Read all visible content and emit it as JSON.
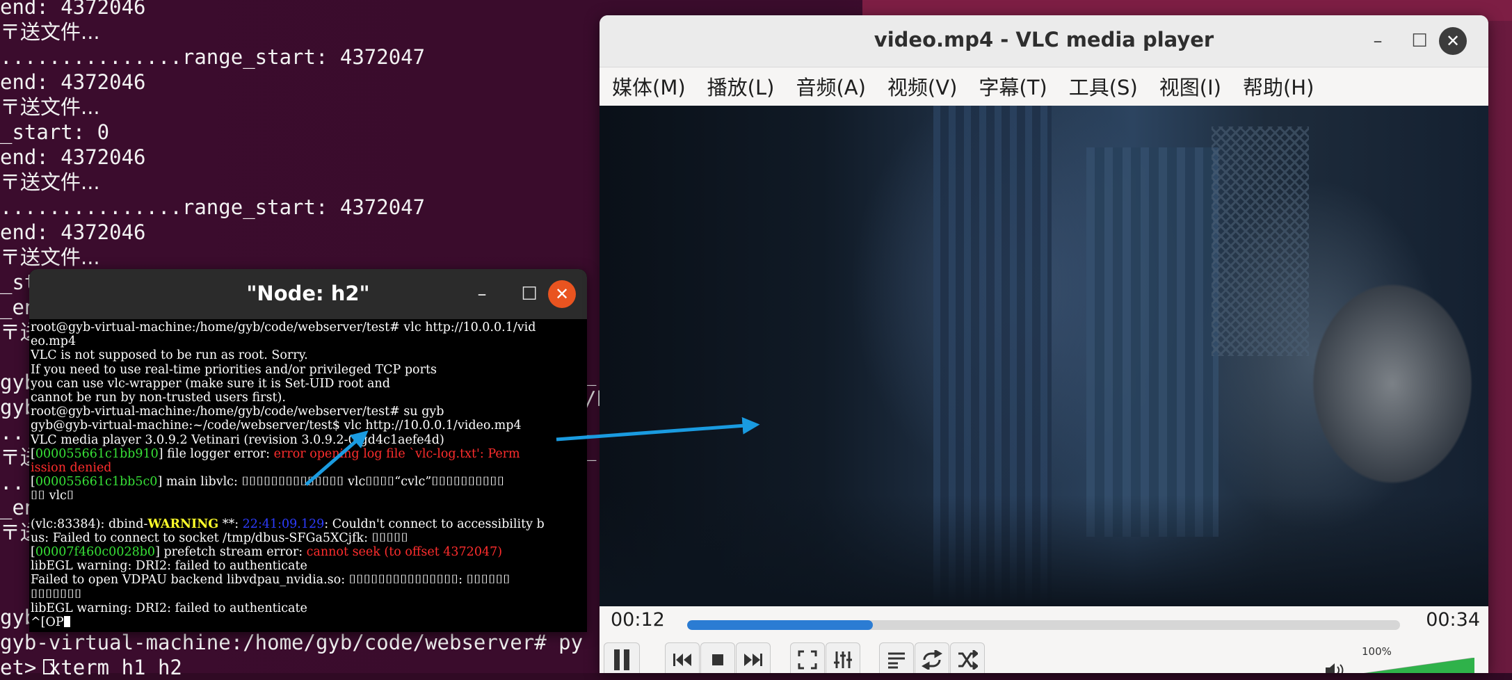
{
  "background_terminal": {
    "lines": [
      "end: 4372046",
      "〒送文件...",
      "...............range_start: 4372047",
      "end: 4372046",
      "〒送文件...",
      "_start: 0",
      "end: 4372046",
      "〒送文件...",
      "...............range_start: 4372047",
      "end: 4372046",
      "〒送文件...",
      "_st",
      "_en",
      "〒送",
      "",
      "gyb",
      "gyb",
      "..",
      "〒送",
      "..",
      "_en",
      "〒送",
      ""
    ],
    "right_fragments": [
      "_",
      "/h",
      "_",
      "_",
      ""
    ],
    "bottom_lines": [
      "gyb",
      "gyb-virtual-machine:/home/gyb/code/webserver# py",
      "et> xterm h1 h2"
    ]
  },
  "xterm": {
    "title": "\"Node: h2\"",
    "min_glyph": "–",
    "max_glyph": "☐",
    "close_glyph": "✕",
    "lines": [
      {
        "t": "root@gyb-virtual-machine:/home/gyb/code/webserver/test# vlc http://10.0.0.1/vid"
      },
      {
        "t": "eo.mp4"
      },
      {
        "t": "VLC is not supposed to be run as root. Sorry."
      },
      {
        "t": "If you need to use real-time priorities and/or privileged TCP ports"
      },
      {
        "t": "you can use vlc-wrapper (make sure it is Set-UID root and"
      },
      {
        "t": "cannot be run by non-trusted users first)."
      },
      {
        "t": "root@gyb-virtual-machine:/home/gyb/code/webserver/test# su gyb"
      },
      {
        "t": "gyb@gyb-virtual-machine:~/code/webserver/test$ vlc http://10.0.0.1/video.mp4"
      },
      {
        "t": "VLC media player 3.0.9.2 Vetinari (revision 3.0.9.2-0-gd4c1aefe4d)"
      },
      {
        "a": "[",
        "b": "000055661c1bb910",
        "c": "] file logger error: ",
        "d": "error opening log file `vlc-log.txt': Perm"
      },
      {
        "d": "ission denied"
      },
      {
        "a": "[",
        "b": "000055661c1bb5c0",
        "c": "] main libvlc: ⌷⌷⌷⌷⌷⌷⌷⌷⌷⌷⌷⌷⌷⌷ vlc⌷⌷⌷⌷“cvlc”⌷⌷⌷⌷⌷⌷⌷⌷⌷⌷"
      },
      {
        "t": "⌷⌷ vlc⌷"
      },
      {
        "t": ""
      },
      {
        "w1": "(vlc:83384): dbind-",
        "w2": "WARNING",
        "w3": " **: ",
        "w4": "22:41:09.129",
        "w5": ": Couldn't connect to accessibility b"
      },
      {
        "t": "us: Failed to connect to socket /tmp/dbus-SFGa5XCjfk: ⌷⌷⌷⌷⌷"
      },
      {
        "a": "[",
        "b": "00007f460c0028b0",
        "c": "] prefetch stream error: ",
        "d": "cannot seek (to offset 4372047)"
      },
      {
        "t": "libEGL warning: DRI2: failed to authenticate"
      },
      {
        "t": "Failed to open VDPAU backend libvdpau_nvidia.so: ⌷⌷⌷⌷⌷⌷⌷⌷⌷⌷⌷⌷⌷⌷⌷: ⌷⌷⌷⌷⌷⌷"
      },
      {
        "t": "⌷⌷⌷⌷⌷⌷⌷"
      },
      {
        "t": "libEGL warning: DRI2: failed to authenticate"
      },
      {
        "t": "^[OP"
      }
    ]
  },
  "vlc": {
    "title": "video.mp4 - VLC media player",
    "min_glyph": "–",
    "max_glyph": "☐",
    "close_glyph": "✕",
    "menu": [
      "媒体(M)",
      "播放(L)",
      "音频(A)",
      "视频(V)",
      "字幕(T)",
      "工具(S)",
      "视图(I)",
      "帮助(H)"
    ],
    "time_elapsed": "00:12",
    "time_total": "00:34",
    "progress_fraction": 0.26,
    "volume_label": "100%",
    "volume_fraction": 1.0,
    "accent_color": "#2b7cd3",
    "controls": [
      "pause-icon",
      "previous-icon",
      "stop-icon",
      "next-icon",
      "fullscreen-icon",
      "extended-settings-icon",
      "playlist-icon",
      "loop-icon",
      "shuffle-icon",
      "volume-icon"
    ]
  },
  "annotation_arrow_color": "#1a9be0"
}
